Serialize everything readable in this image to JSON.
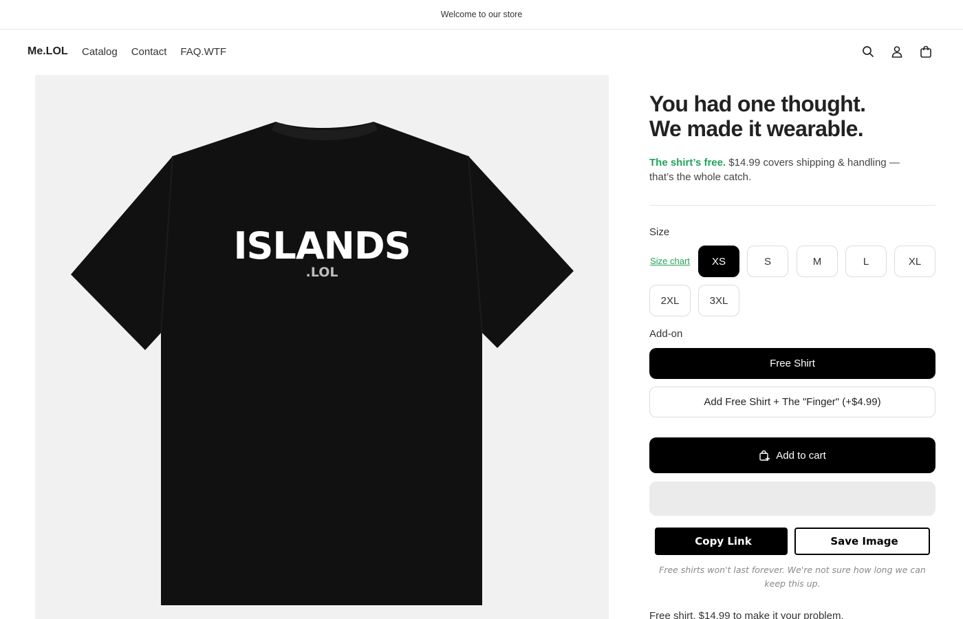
{
  "announcement": {
    "text": "Welcome to our store"
  },
  "header": {
    "logo": "Me.LOL",
    "nav": [
      "Catalog",
      "Contact",
      "FAQ.WTF"
    ],
    "icons": [
      "search-icon",
      "account-icon",
      "cart-icon"
    ]
  },
  "product_image": {
    "shirt_color": "#111111",
    "print_main": "ISLANDS",
    "print_sub": ".LOL"
  },
  "product": {
    "title_line1": "You had one thought.",
    "title_line2": "We made it wearable.",
    "subtitle_highlight": "The shirt’s free.",
    "subtitle_rest": " $14.99 covers shipping & handling — that’s the whole catch.",
    "accent_color": "#22a35a"
  },
  "size": {
    "label": "Size",
    "chart_link": "Size chart",
    "options": [
      "XS",
      "S",
      "M",
      "L",
      "XL",
      "2XL",
      "3XL"
    ],
    "selected": "XS"
  },
  "addon": {
    "label": "Add-on",
    "options": [
      "Free Shirt",
      "Add Free Shirt + The \"Finger\" (+$4.99)"
    ],
    "selected": "Free Shirt"
  },
  "cart": {
    "label": "Add to cart",
    "icon": "bag-plus-icon"
  },
  "share": {
    "copy_icon_glyph": "",
    "copy_label": "Copy Link",
    "save_icon_glyph": "",
    "save_label": "Save Image"
  },
  "disclaimer": "Free shirts won't last forever. We're not sure how long we can keep this up.",
  "footnote": "Free shirt. $14.99 to make it your problem."
}
